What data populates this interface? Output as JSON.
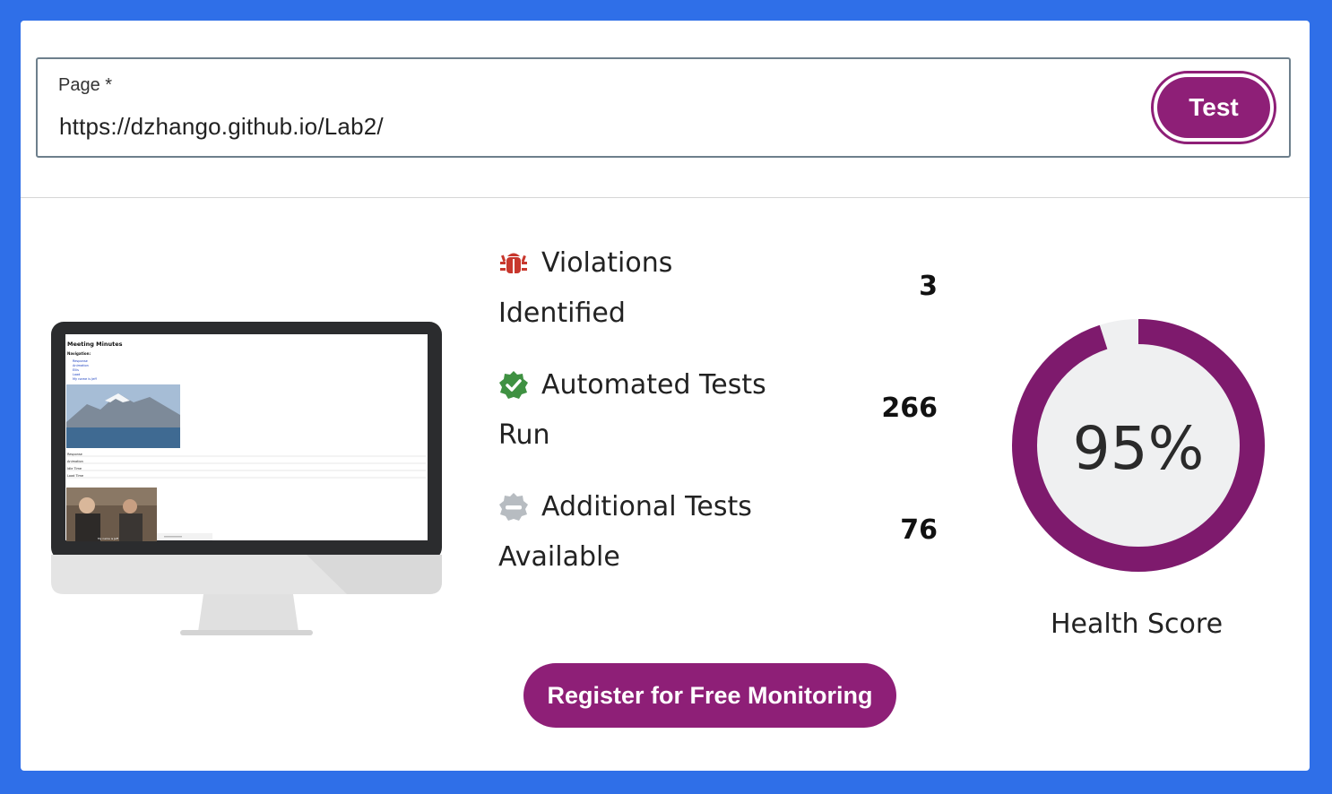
{
  "form": {
    "label": "Page *",
    "url": "https://dzhango.github.io/Lab2/",
    "test_button": "Test"
  },
  "preview": {
    "heading": "Meeting Minutes",
    "nav_label": "Navigation:",
    "nav_items": [
      "Response",
      "Animation",
      "Ellis",
      "Load",
      "My name is Jeff"
    ],
    "sections": [
      "Response",
      "Animation",
      "Idle Time",
      "Load Time"
    ],
    "video_caption": "My name is Jeff"
  },
  "stats": [
    {
      "icon": "bug-icon",
      "line1": "Violations",
      "line2": "Identified",
      "value": "3",
      "color": "#c8372d"
    },
    {
      "icon": "check-badge-icon",
      "line1": "Automated Tests",
      "line2": "Run",
      "value": "266",
      "color": "#3f9142"
    },
    {
      "icon": "minus-badge-icon",
      "line1": "Additional Tests",
      "line2": "Available",
      "value": "76",
      "color": "#b7bcc1"
    }
  ],
  "health": {
    "score_label": "95%",
    "score": 0.95,
    "label": "Health Score",
    "color": "#7e1a6d"
  },
  "register_button": "Register for Free Monitoring"
}
